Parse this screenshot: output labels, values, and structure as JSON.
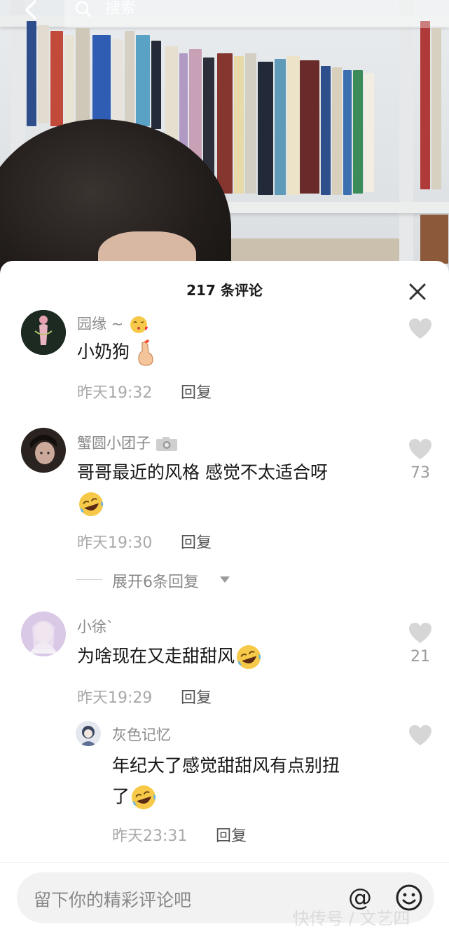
{
  "search": {
    "placeholder": "搜索"
  },
  "comments_header": {
    "title": "217 条评论"
  },
  "comments": [
    {
      "user": "园缘 ~",
      "text": "小奶狗",
      "time": "昨天19:32",
      "reply_label": "回复",
      "likes": ""
    },
    {
      "user": "蟹圆小团子",
      "text": "哥哥最近的风格 感觉不太适合呀",
      "time": "昨天19:30",
      "reply_label": "回复",
      "likes": "73",
      "expand_label": "展开6条回复"
    },
    {
      "user": "小徐`",
      "text": "为啥现在又走甜甜风",
      "time": "昨天19:29",
      "reply_label": "回复",
      "likes": "21",
      "replies": [
        {
          "user": "灰色记忆",
          "text_line1": "年纪大了感觉甜甜风有点别扭",
          "text_line2": "了",
          "time": "昨天23:31",
          "reply_label": "回复",
          "likes": ""
        }
      ]
    }
  ],
  "input": {
    "placeholder": "留下你的精彩评论吧",
    "at_symbol": "@"
  },
  "watermark": "快传号 / 文艺四",
  "colors": {
    "sheet_bg": "#ffffff",
    "input_bg": "#f2f2f2",
    "meta_gray": "#a9a9a9",
    "like_gray": "#d2d2d2"
  },
  "icons": [
    "back-icon",
    "search-icon",
    "close-icon",
    "heart-icon",
    "at-icon",
    "emoji-icon",
    "laugh-cry-emoji",
    "finger-heart-emoji",
    "kiss-emoji",
    "camera-icon"
  ]
}
